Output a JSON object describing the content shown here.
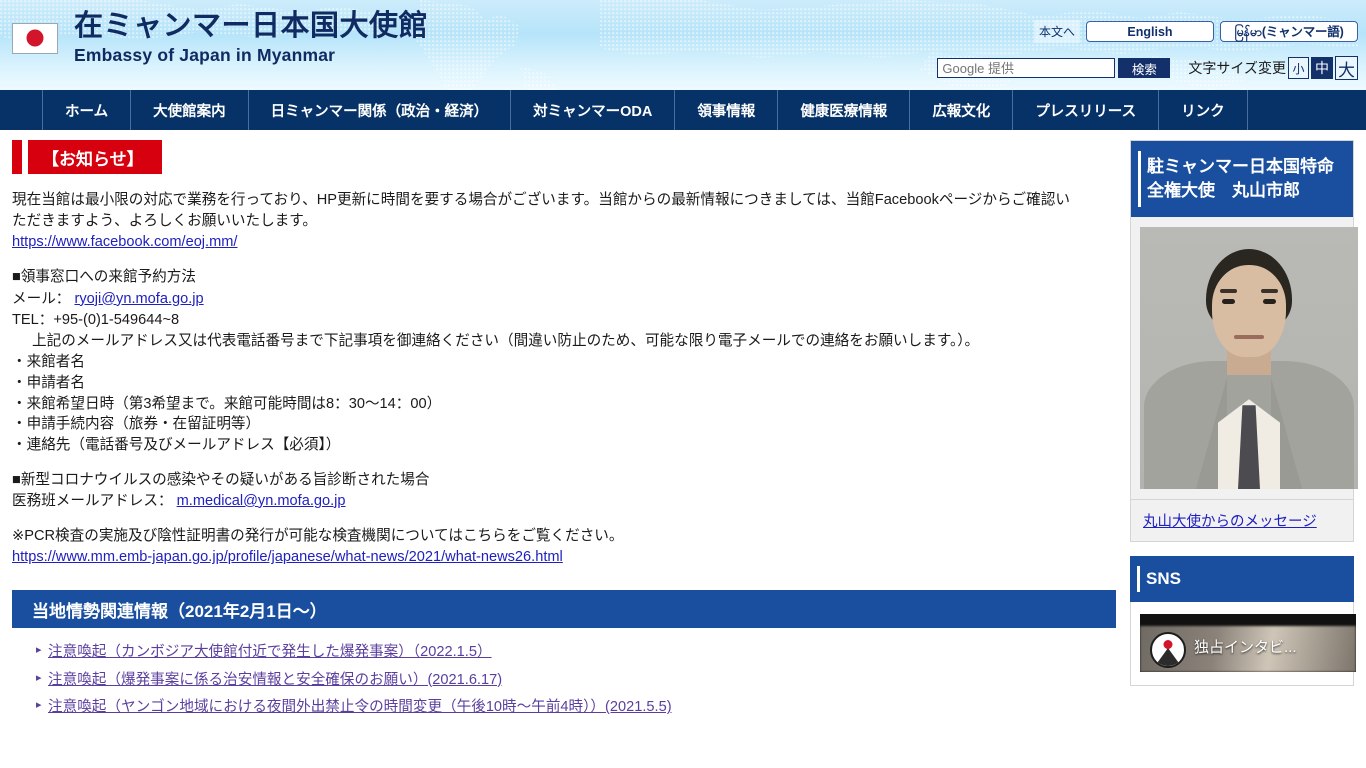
{
  "header": {
    "flag_icon": "japan-flag-icon",
    "title_jp": "在ミャンマー日本国大使館",
    "title_en": "Embassy of Japan in Myanmar",
    "skip_link": "本文へ",
    "lang_english": "English",
    "lang_myanmar": "မြန်မာ(ミャンマー語)",
    "search": {
      "placeholder": "Google 提供",
      "value": "",
      "button": "検索",
      "icon": "search-icon"
    },
    "font_size": {
      "label": "文字サイズ変更",
      "options": [
        "小",
        "中",
        "大"
      ],
      "selected": "中"
    },
    "colors": {
      "banner_top": "#cdecfb",
      "banner_bottom": "#eefaff",
      "brand_navy": "#102a62"
    }
  },
  "nav": {
    "items": [
      {
        "label": "ホーム"
      },
      {
        "label": "大使館案内"
      },
      {
        "label": "日ミャンマー関係（政治・経済）"
      },
      {
        "label": "対ミャンマーODA"
      },
      {
        "label": "領事情報"
      },
      {
        "label": "健康医療情報"
      },
      {
        "label": "広報文化"
      },
      {
        "label": "プレスリリース"
      },
      {
        "label": "リンク"
      }
    ],
    "bg_color": "#073268"
  },
  "main": {
    "notice_heading": "【お知らせ】",
    "notice_heading_color": "#d7000f",
    "intro_line1": "現在当館は最小限の対応で業務を行っており、HP更新に時間を要する場合がございます。当館からの最新情報につきましては、当館Facebookページからご確認い",
    "intro_line2": "ただきますよう、よろしくお願いいたします。",
    "facebook_url": "https://www.facebook.com/eoj.mm/",
    "consular": {
      "heading": "■領事窓口への来館予約方法",
      "mail_label": "メール：",
      "mail_address": "ryoji@yn.mofa.go.jp",
      "tel": "TEL：+95-(0)1-549644~8",
      "instruction": "上記のメールアドレス又は代表電話番号まで下記事項を御連絡ください（間違い防止のため、可能な限り電子メールでの連絡をお願いします。）。",
      "items": [
        "・来館者名",
        "・申請者名",
        "・来館希望日時（第3希望まで。来館可能時間は8：30〜14：00）",
        "・申請手続内容（旅券・在留証明等）",
        "・連絡先（電話番号及びメールアドレス【必須】）"
      ]
    },
    "covid": {
      "heading": "■新型コロナウイルスの感染やその疑いがある旨診断された場合",
      "mail_label": "医務班メールアドレス：",
      "mail_address": "m.medical@yn.mofa.go.jp",
      "pcr_note": "※PCR検査の実施及び陰性証明書の発行が可能な検査機関についてはこちらをご覧ください。",
      "pcr_url": "https://www.mm.emb-japan.go.jp/profile/japanese/what-news/2021/what-news26.html"
    },
    "situation": {
      "heading": "当地情勢関連情報（2021年2月1日〜）",
      "heading_color": "#1a4fa0",
      "links": [
        "注意喚起（カンボジア大使館付近で発生した爆発事案）（2022.1.5）",
        "注意喚起（爆発事案に係る治安情報と安全確保のお願い）(2021.6.17)",
        "注意喚起（ヤンゴン地域における夜間外出禁止令の時間変更（午後10時〜午前4時））(2021.5.5)"
      ]
    }
  },
  "sidebar": {
    "ambassador": {
      "heading": "駐ミャンマー日本国特命全権大使　丸山市郎",
      "photo_alt": "ambassador-portrait",
      "message_link": "丸山大使からのメッセージ"
    },
    "sns": {
      "heading": "SNS",
      "video_title": "独占インタビ...",
      "video_avatar_icon": "japan-emblem-icon"
    }
  }
}
